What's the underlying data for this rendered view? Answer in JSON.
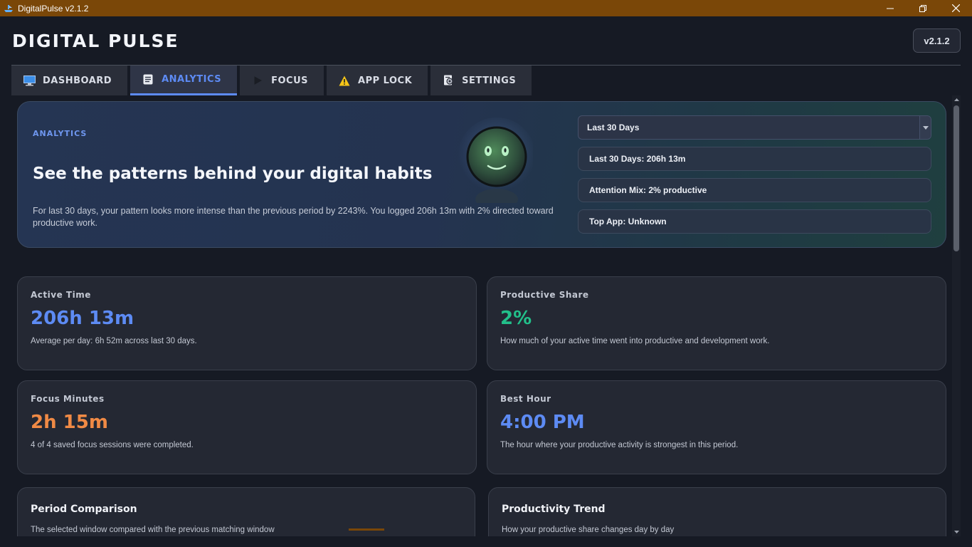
{
  "window": {
    "title": "DigitalPulse v2.1.2"
  },
  "header": {
    "brand": "DIGITAL PULSE",
    "version": "v2.1.2"
  },
  "tabs": [
    {
      "label": "DASHBOARD",
      "icon": "monitor-icon"
    },
    {
      "label": "ANALYTICS",
      "icon": "document-icon",
      "active": true
    },
    {
      "label": "FOCUS",
      "icon": "play-icon"
    },
    {
      "label": "APP LOCK",
      "icon": "warning-icon"
    },
    {
      "label": "SETTINGS",
      "icon": "settings-icon"
    }
  ],
  "hero": {
    "eyebrow": "ANALYTICS",
    "headline": "See the patterns behind your digital habits",
    "description": "For last 30 days, your pattern looks more intense than the previous period by 2243%. You logged 206h 13m with 2% directed toward productive work.",
    "range_select": "Last 30 Days",
    "pills": [
      "Last 30 Days: 206h 13m",
      "Attention Mix: 2% productive",
      "Top App: Unknown"
    ]
  },
  "stats": {
    "active_time": {
      "label": "Active Time",
      "value": "206h 13m",
      "note": "Average per day: 6h 52m across last 30 days."
    },
    "productive_share": {
      "label": "Productive Share",
      "value": "2%",
      "note": "How much of your active time went into productive and development work."
    },
    "focus_minutes": {
      "label": "Focus Minutes",
      "value": "2h 15m",
      "note": "4 of 4 saved focus sessions were completed."
    },
    "best_hour": {
      "label": "Best Hour",
      "value": "4:00 PM",
      "note": "The hour where your productive activity is strongest in this period."
    }
  },
  "charts": {
    "period_comparison": {
      "title": "Period Comparison",
      "subtitle": "The selected window compared with the previous matching window"
    },
    "productivity_trend": {
      "title": "Productivity Trend",
      "subtitle": "How your productive share changes day by day"
    }
  },
  "colors": {
    "titlebar": "#7a4708",
    "accent_blue": "#5d8bf4",
    "accent_green": "#22c08a",
    "accent_orange": "#f08a45"
  }
}
